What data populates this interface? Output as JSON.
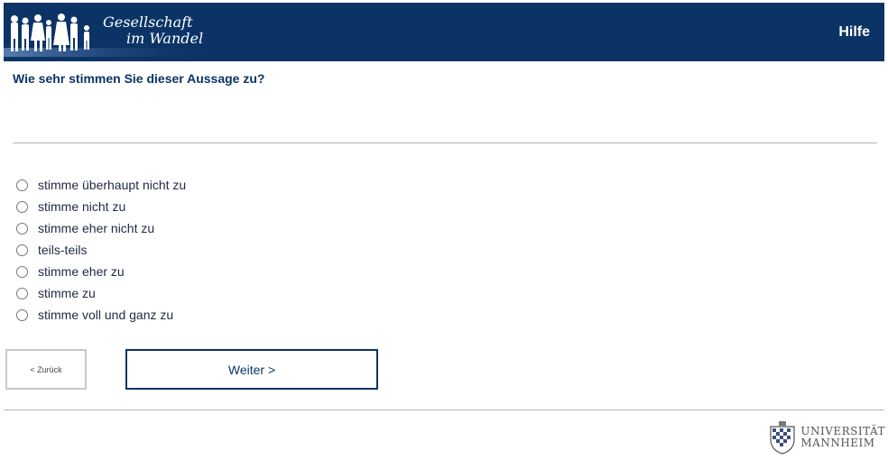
{
  "header": {
    "logo_line1": "Gesellschaft",
    "logo_line2": "im Wandel",
    "help_label": "Hilfe",
    "bg_color": "#0b3366"
  },
  "question": {
    "text": "Wie sehr stimmen Sie dieser Aussage zu?"
  },
  "options": [
    {
      "label": "stimme überhaupt nicht zu",
      "selected": false
    },
    {
      "label": "stimme nicht zu",
      "selected": false
    },
    {
      "label": "stimme eher nicht zu",
      "selected": false
    },
    {
      "label": "teils-teils",
      "selected": false
    },
    {
      "label": "stimme eher zu",
      "selected": false
    },
    {
      "label": "stimme zu",
      "selected": false
    },
    {
      "label": "stimme voll und ganz zu",
      "selected": false
    }
  ],
  "nav": {
    "back_label": "< Zurück",
    "next_label": "Weiter >"
  },
  "footer": {
    "uni_line1": "UNIVERSITÄT",
    "uni_line2": "MANNHEIM"
  }
}
